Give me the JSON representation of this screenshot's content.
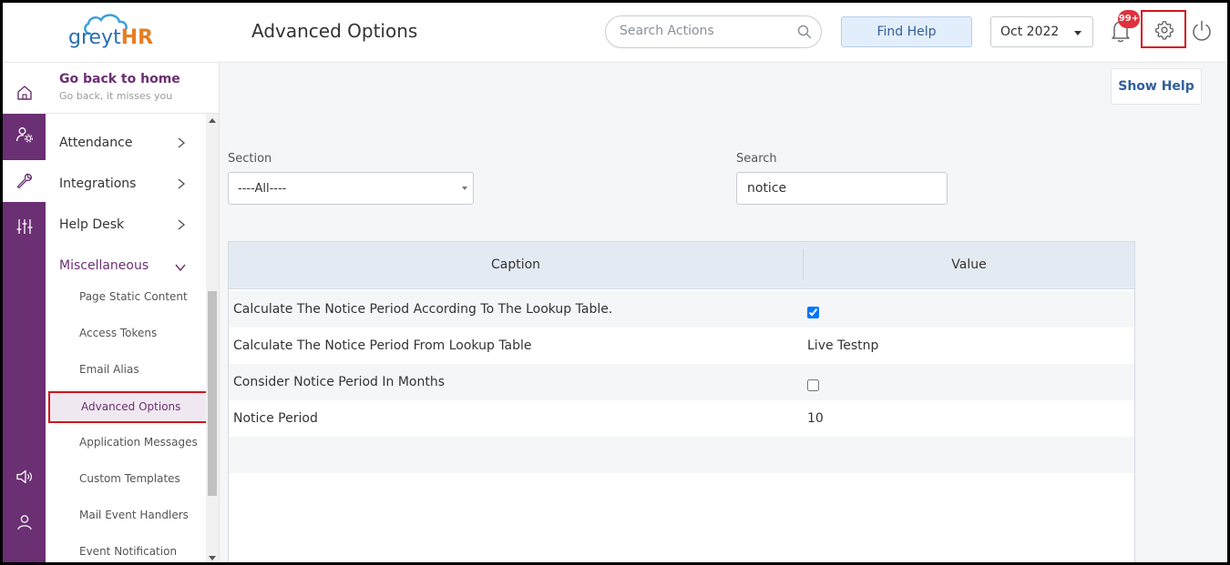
{
  "header": {
    "logo_grey": "greyt",
    "logo_hr": "HR",
    "page_title": "Advanced Options",
    "search_placeholder": "Search Actions",
    "find_help": "Find Help",
    "month": "Oct 2022",
    "notification_count": "99+"
  },
  "sidebar": {
    "home_title": "Go back to home",
    "home_subtitle": "Go back, it misses you",
    "menu": [
      {
        "label": "Attendance"
      },
      {
        "label": "Integrations"
      },
      {
        "label": "Help Desk"
      },
      {
        "label": "Miscellaneous"
      }
    ],
    "submenu": [
      {
        "label": "Page Static Content"
      },
      {
        "label": "Access Tokens"
      },
      {
        "label": "Email Alias"
      },
      {
        "label": "Advanced Options"
      },
      {
        "label": "Application Messages"
      },
      {
        "label": "Custom Templates"
      },
      {
        "label": "Mail Event Handlers"
      },
      {
        "label": "Event Notification"
      }
    ]
  },
  "main": {
    "show_help": "Show Help",
    "section_label": "Section",
    "section_value": "----All----",
    "search_label": "Search",
    "search_value": "notice",
    "table": {
      "headers": [
        "Caption",
        "Value"
      ],
      "rows": [
        {
          "caption": "Calculate The Notice Period According To The Lookup Table.",
          "type": "checkbox",
          "checked": true
        },
        {
          "caption": "Calculate The Notice Period From Lookup Table",
          "type": "text",
          "value": "Live Testnp"
        },
        {
          "caption": "Consider Notice Period In Months",
          "type": "checkbox",
          "checked": false
        },
        {
          "caption": "Notice Period",
          "type": "text",
          "value": "10"
        }
      ]
    }
  },
  "colors": {
    "brand_purple": "#6b2f73",
    "highlight_red": "#d0161c",
    "link_blue": "#2f5f9e"
  }
}
